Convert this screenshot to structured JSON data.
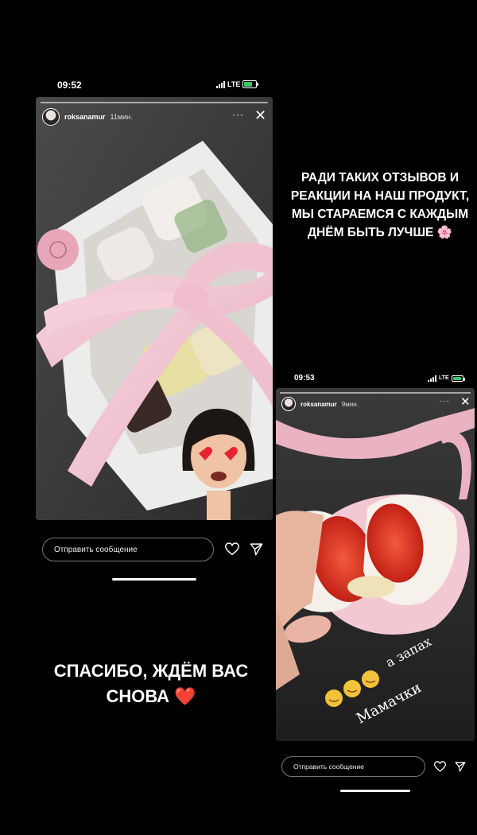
{
  "screenshot1": {
    "time": "09:52",
    "network": "LTE",
    "username": "roksanamur",
    "time_ago": "11мин.",
    "reply_placeholder": "Отправить сообщение"
  },
  "screenshot2": {
    "time": "09:53",
    "network": "LTE",
    "username": "roksanamur",
    "time_ago": "9мин.",
    "reply_placeholder": "Отправить сообщение",
    "handwritten_line1": "а запах",
    "handwritten_line2": "Мамачки"
  },
  "caption_top": {
    "line1": "РАДИ ТАКИХ ОТЗЫВОВ И",
    "line2": "РЕАКЦИИ НА НАШ ПРОДУКТ,",
    "line3": "МЫ СТАРАЕМСЯ С КАЖДЫМ",
    "line4": "ДНЁМ БЫТЬ ЛУЧШЕ",
    "emoji": "🌸"
  },
  "caption_bottom": {
    "line1": "СПАСИБО, ЖДЁМ ВАС",
    "line2": "СНОВА",
    "emoji": "❤️"
  },
  "colors": {
    "background": "#000000",
    "ribbon": "#f2c6d3",
    "strawberry": "#d7261c"
  }
}
